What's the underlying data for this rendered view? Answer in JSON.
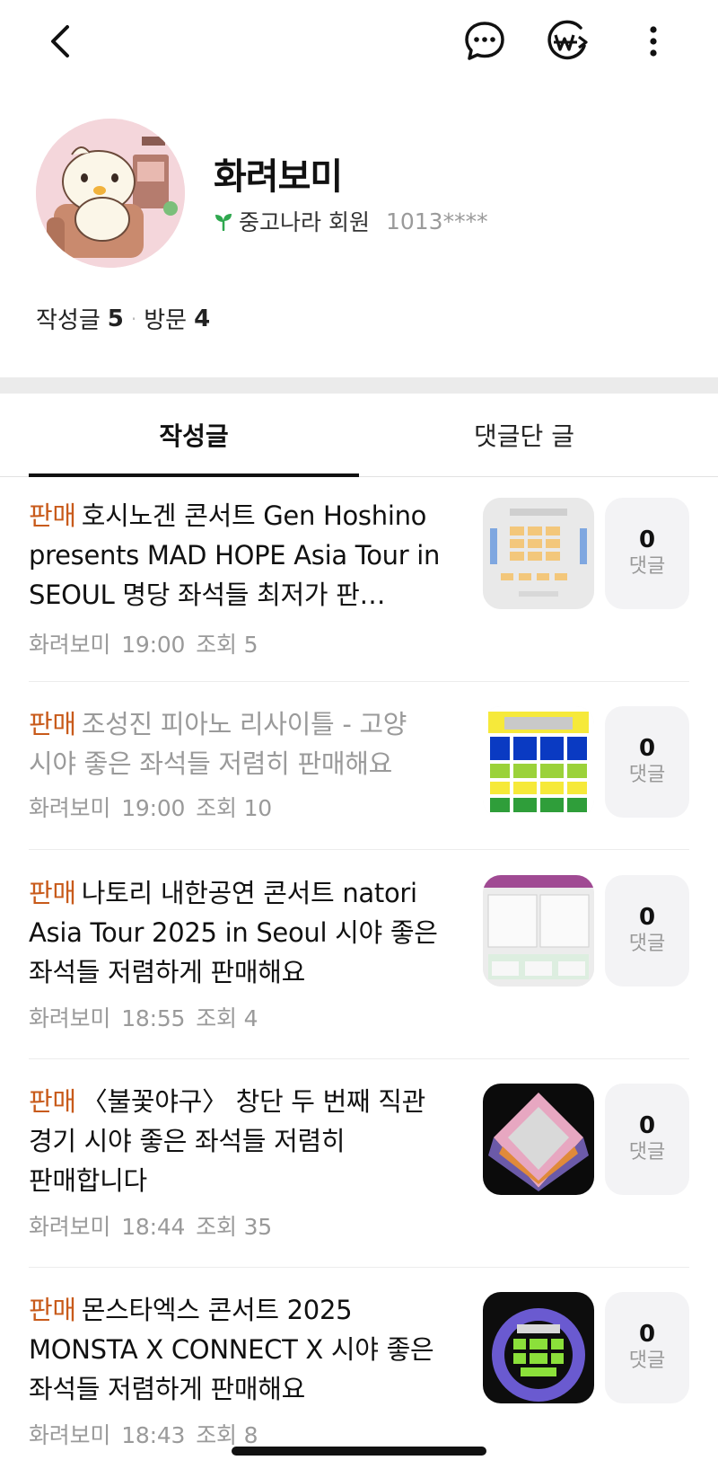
{
  "profile": {
    "nickname": "화려보미",
    "member_label": "중고나라 회원",
    "user_id": "1013****",
    "stats": {
      "posts_label": "작성글",
      "posts_count": "5",
      "visits_label": "방문",
      "visits_count": "4"
    }
  },
  "tabs": [
    {
      "label": "작성글",
      "active": true
    },
    {
      "label": "댓글단 글",
      "active": false
    }
  ],
  "posts": [
    {
      "badge": "판매",
      "title": "호시노겐 콘서트 Gen Hoshino presents MAD HOPE Asia Tour in SEOUL 명당 좌석들 최저가 판…",
      "author": "화려보미",
      "time": "19:00",
      "views": "조회 5",
      "comment_count": "0",
      "comment_label": "댓글",
      "thumbnail": "seat-map-gray",
      "dimmed": false
    },
    {
      "badge": "판매",
      "title": "조성진 피아노 리사이틀 - 고양 시야 좋은 좌석들 저렴히 판매해요",
      "author": "화려보미",
      "time": "19:00",
      "views": "조회 10",
      "comment_count": "0",
      "comment_label": "댓글",
      "thumbnail": "seat-map-blue-yellow",
      "dimmed": true
    },
    {
      "badge": "판매",
      "title": "나토리 내한공연 콘서트 natori Asia Tour 2025 in Seoul 시야 좋은 좌석들 저렴하게 판매해요",
      "author": "화려보미",
      "time": "18:55",
      "views": "조회 4",
      "comment_count": "0",
      "comment_label": "댓글",
      "thumbnail": "seat-map-standing",
      "dimmed": false
    },
    {
      "badge": "판매",
      "title": "〈불꽃야구〉 창단 두 번째 직관 경기 시야 좋은 좌석들 저렴히 판매합니다",
      "author": "화려보미",
      "time": "18:44",
      "views": "조회 35",
      "comment_count": "0",
      "comment_label": "댓글",
      "thumbnail": "stadium-map",
      "dimmed": false
    },
    {
      "badge": "판매",
      "title": "몬스타엑스 콘서트 2025 MONSTA X CONNECT X 시야 좋은 좌석들 저렴하게 판매해요",
      "author": "화려보미",
      "time": "18:43",
      "views": "조회 8",
      "comment_count": "0",
      "comment_label": "댓글",
      "thumbnail": "arena-map-dark",
      "dimmed": false
    }
  ],
  "colors": {
    "badge": "#c85a1a",
    "meta": "#9a9a9a",
    "divider": "#ebebeb",
    "comment_bg": "#f3f3f5",
    "sprout": "#2fa84f"
  }
}
